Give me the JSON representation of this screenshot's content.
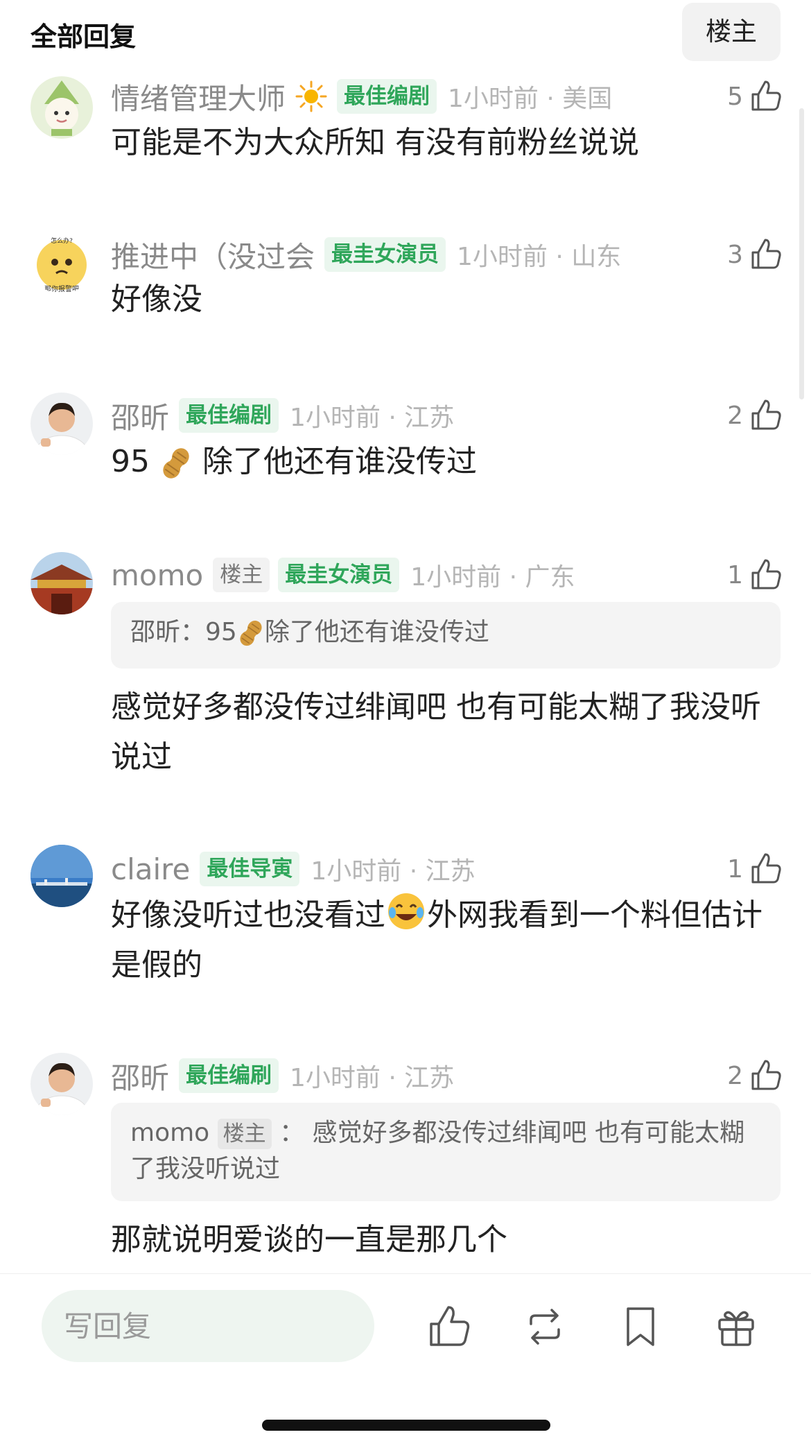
{
  "header": {
    "title": "全部回复",
    "filter_button": "楼主"
  },
  "comments": [
    {
      "username": "情绪管理大师",
      "tags": [
        "最佳编剧"
      ],
      "time": "1小时前 · 美国",
      "likes": "5",
      "text": "可能是不为大众所知 有没有前粉丝说说"
    },
    {
      "username": "推进中（没过会",
      "tags": [
        "最圭女演员"
      ],
      "time": "1小时前 · 山东",
      "likes": "3",
      "text": "好像没",
      "avatar_caption_top": "怎么办?",
      "avatar_caption": "那你报警吧"
    },
    {
      "username": "邵昕",
      "tags": [
        "最佳编剧"
      ],
      "time": "1小时前 · 江苏",
      "likes": "2",
      "text_before": "95",
      "text_after": "除了他还有谁没传过"
    },
    {
      "username": "momo",
      "tags": [
        "楼主",
        "最圭女演员"
      ],
      "time": "1小时前 · 广东",
      "likes": "1",
      "quote": {
        "author": "邵昕",
        "sep": "：",
        "before": "95",
        "after": "除了他还有谁没传过"
      },
      "text": "感觉好多都没传过绯闻吧 也有可能太糊了我没听说过"
    },
    {
      "username": "claire",
      "tags": [
        "最佳导寅"
      ],
      "time": "1小时前 · 江苏",
      "likes": "1",
      "text_before": "好像没听过也没看过",
      "text_after": "外网我看到一个料但估计是假的"
    },
    {
      "username": "邵昕",
      "tags": [
        "最佳编刷"
      ],
      "time": "1小时前 · 江苏",
      "likes": "2",
      "quote": {
        "author": "momo",
        "tag": "楼主",
        "sep": " ： ",
        "text": "感觉好多都没传过绯闻吧 也有可能太糊了我没听说过"
      },
      "text": "那就说明爱谈的一直是那几个"
    }
  ],
  "bottom_bar": {
    "reply_placeholder": "写回复"
  },
  "colors": {
    "accent_green": "#2fa65a",
    "tag_bg": "#eaf6ee",
    "muted_text": "#8a8a8a"
  }
}
